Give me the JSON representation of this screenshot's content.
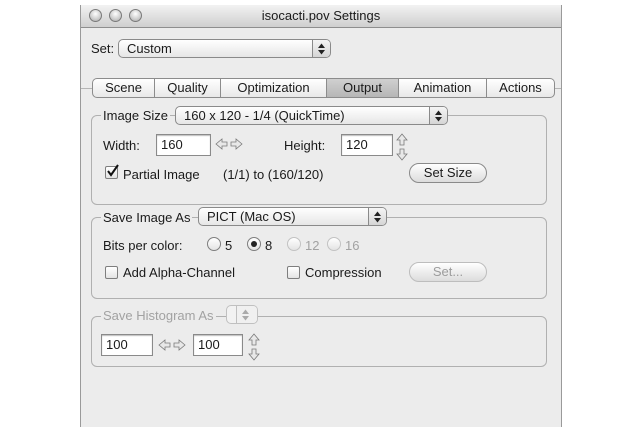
{
  "window": {
    "title": "isocacti.pov Settings"
  },
  "set": {
    "label": "Set:",
    "value": "Custom"
  },
  "tabs": [
    {
      "label": "Scene"
    },
    {
      "label": "Quality"
    },
    {
      "label": "Optimization"
    },
    {
      "label": "Output"
    },
    {
      "label": "Animation"
    },
    {
      "label": "Actions"
    }
  ],
  "selected_tab": "Output",
  "image_size": {
    "label": "Image Size",
    "preset": "160 x 120 - 1/4 (QuickTime)",
    "width_label": "Width:",
    "width_value": "160",
    "height_label": "Height:",
    "height_value": "120",
    "partial_label": "Partial Image",
    "partial_checked": true,
    "range_text": "(1/1) to (160/120)",
    "set_size_button": "Set Size"
  },
  "save_image": {
    "label": "Save Image As",
    "format": "PICT (Mac OS)",
    "bits_label": "Bits per color:",
    "bits_options": [
      "5",
      "8",
      "12",
      "16"
    ],
    "bits_selected": "8",
    "alpha_label": "Add Alpha-Channel",
    "alpha_checked": false,
    "compression_label": "Compression",
    "compression_checked": false,
    "set_button": "Set..."
  },
  "histogram": {
    "label": "Save Histogram As",
    "value1": "100",
    "value2": "100"
  },
  "icons": [
    "close-button",
    "minimize-button",
    "zoom-button",
    "popup-arrows-icon",
    "left-right-arrows-icon",
    "up-down-arrows-icon",
    "checkmark-icon"
  ],
  "colors": {
    "window_bg": "#ececec",
    "selected_tab": "#c4c4c4",
    "disabled_text": "#a2a2a2"
  }
}
